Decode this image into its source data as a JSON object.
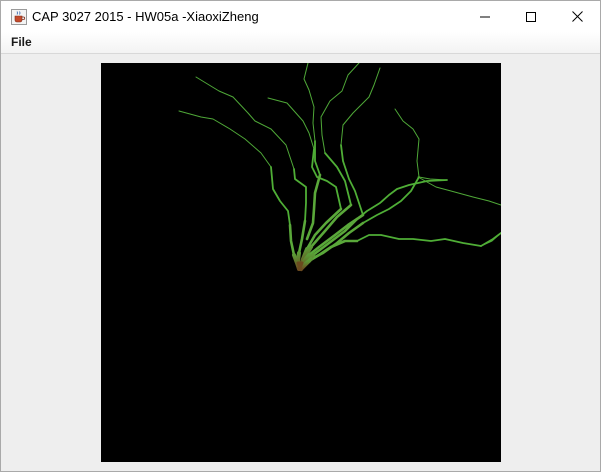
{
  "window": {
    "title": "CAP 3027 2015 - HW05a -XiaoxiZheng",
    "app_icon": "java-cup-icon",
    "controls": {
      "minimize_icon": "minimize-icon",
      "maximize_icon": "maximize-icon",
      "close_icon": "close-icon"
    }
  },
  "menubar": {
    "items": [
      {
        "label": "File"
      }
    ]
  },
  "canvas": {
    "background": "#000000",
    "content": "fractal tree (branches growing up and right)",
    "branch_color_tip": "#5fb43c",
    "branch_color_base": "#6b4a1f"
  }
}
